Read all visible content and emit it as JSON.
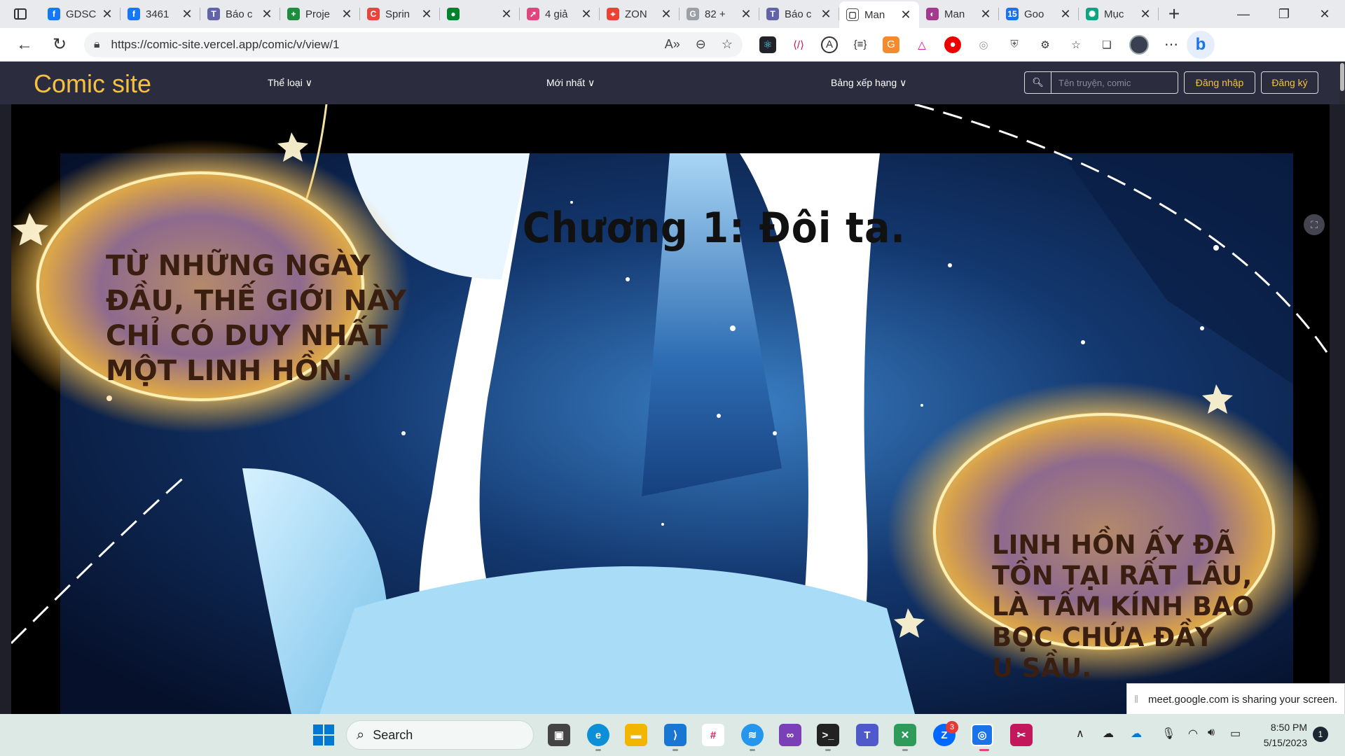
{
  "browser": {
    "tabs": [
      {
        "label": "GDSC",
        "icon": "facebook-icon",
        "color": "#1877f2",
        "glyph": "f"
      },
      {
        "label": "3461",
        "icon": "facebook-icon",
        "color": "#1877f2",
        "glyph": "f"
      },
      {
        "label": "Báo c",
        "icon": "teams-icon",
        "color": "#6264a7",
        "glyph": "T"
      },
      {
        "label": "Proje",
        "icon": "sheets-icon",
        "color": "#1e8e3e",
        "glyph": "+"
      },
      {
        "label": "Sprin",
        "icon": "app-icon",
        "color": "#e8453c",
        "glyph": "C"
      },
      {
        "label": "",
        "icon": "meet-icon",
        "color": "#00832d",
        "glyph": "●"
      },
      {
        "label": "4 giả",
        "icon": "rocket-icon",
        "color": "#e0457b",
        "glyph": "➚"
      },
      {
        "label": "ZON",
        "icon": "maps-icon",
        "color": "#ea4335",
        "glyph": "⌖"
      },
      {
        "label": "82 +",
        "icon": "google-icon",
        "color": "#9aa0a6",
        "glyph": "G"
      },
      {
        "label": "Báo c",
        "icon": "teams-icon",
        "color": "#6264a7",
        "glyph": "T"
      },
      {
        "label": "Man",
        "icon": "page-icon",
        "color": "#ffffff",
        "glyph": "▢",
        "active": true
      },
      {
        "label": "Man",
        "icon": "manga-icon",
        "color": "#a23b8e",
        "glyph": "◐"
      },
      {
        "label": "Goo",
        "icon": "calendar-icon",
        "color": "#1a73e8",
        "glyph": "15"
      },
      {
        "label": "Mục",
        "icon": "chatgpt-icon",
        "color": "#10a37f",
        "glyph": "✺"
      }
    ],
    "url": "https://comic-site.vercel.app/comic/v/view/1"
  },
  "site": {
    "brand": "Comic site",
    "nav": {
      "genres": "Thể loại ∨",
      "latest": "Mới nhất ∨",
      "ranking": "Bảng xếp hạng ∨"
    },
    "search_placeholder": "Tên truyện, comic",
    "login": "Đăng nhập",
    "register": "Đăng ký"
  },
  "comic": {
    "chapter_title": "Chương 1: Đôi ta.",
    "bubble1": [
      "Từ những ngày",
      "đầu, thế giới này",
      "chỉ có duy nhất",
      "một linh hồn."
    ],
    "bubble2": [
      "Linh hồn ấy đã",
      "tồn tại rất lâu,",
      "là tấm kính bao",
      "bọc chứa đầy",
      "u sầu."
    ]
  },
  "share_notice": "meet.google.com is sharing your screen.",
  "taskbar": {
    "search": "Search",
    "zalo_badge": "3",
    "time": "8:50 PM",
    "date": "5/15/2023",
    "notifications": "1"
  }
}
